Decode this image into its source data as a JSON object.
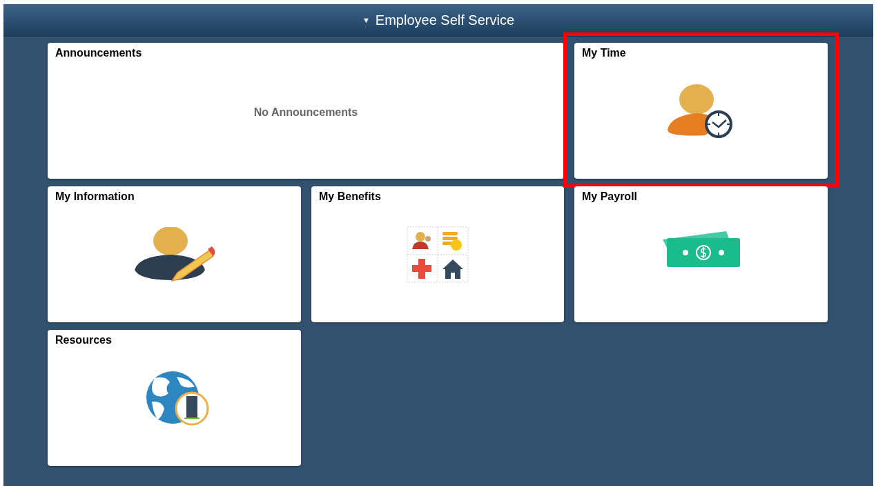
{
  "header": {
    "title": "Employee Self Service",
    "caret": "▼"
  },
  "tiles": [
    {
      "kind": "announcements",
      "title": "Announcements",
      "message": "No Announcements",
      "highlighted": false
    },
    {
      "kind": "icon",
      "title": "My Time",
      "highlighted": true
    },
    {
      "kind": "icon",
      "title": "My Information",
      "highlighted": false
    },
    {
      "kind": "icon",
      "title": "My Benefits",
      "highlighted": false
    },
    {
      "kind": "icon",
      "title": "My Payroll",
      "highlighted": false
    },
    {
      "kind": "icon",
      "title": "Resources",
      "highlighted": false
    }
  ]
}
